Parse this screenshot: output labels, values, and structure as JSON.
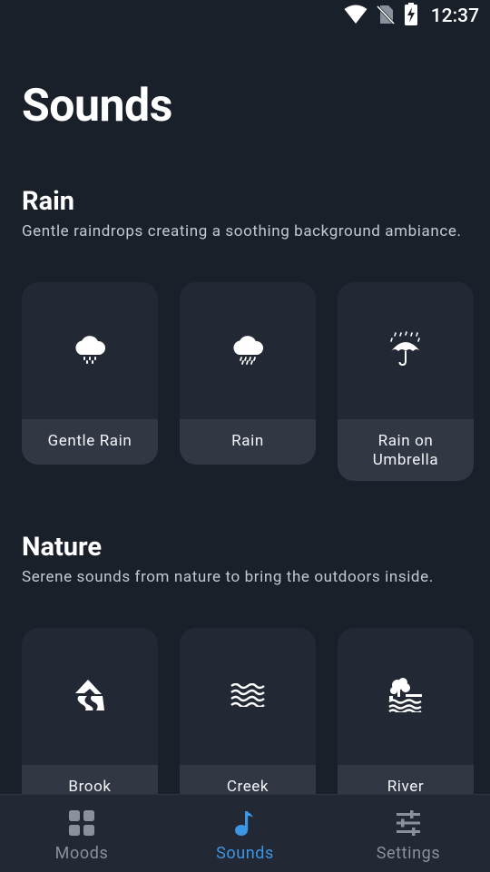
{
  "status_bar": {
    "time": "12:37"
  },
  "page": {
    "title": "Sounds"
  },
  "sections": [
    {
      "title": "Rain",
      "description": "Gentle raindrops creating a soothing background ambiance.",
      "items": [
        {
          "label": "Gentle Rain",
          "icon": "cloud-drizzle-icon"
        },
        {
          "label": "Rain",
          "icon": "cloud-rain-icon"
        },
        {
          "label": "Rain on Umbrella",
          "icon": "umbrella-rain-icon"
        }
      ]
    },
    {
      "title": "Nature",
      "description": "Serene sounds from nature to bring the outdoors inside.",
      "items": [
        {
          "label": "Brook",
          "icon": "mountain-stream-icon"
        },
        {
          "label": "Creek",
          "icon": "water-waves-icon"
        },
        {
          "label": "River",
          "icon": "tree-river-icon"
        }
      ]
    }
  ],
  "bottom_nav": {
    "items": [
      {
        "label": "Moods",
        "icon": "grid-icon",
        "active": false
      },
      {
        "label": "Sounds",
        "icon": "music-note-icon",
        "active": true
      },
      {
        "label": "Settings",
        "icon": "sliders-icon",
        "active": false
      }
    ]
  },
  "colors": {
    "background": "#19202a",
    "card": "#222834",
    "card_label": "#323843",
    "accent": "#3d95e6",
    "inactive": "#8b919c"
  }
}
